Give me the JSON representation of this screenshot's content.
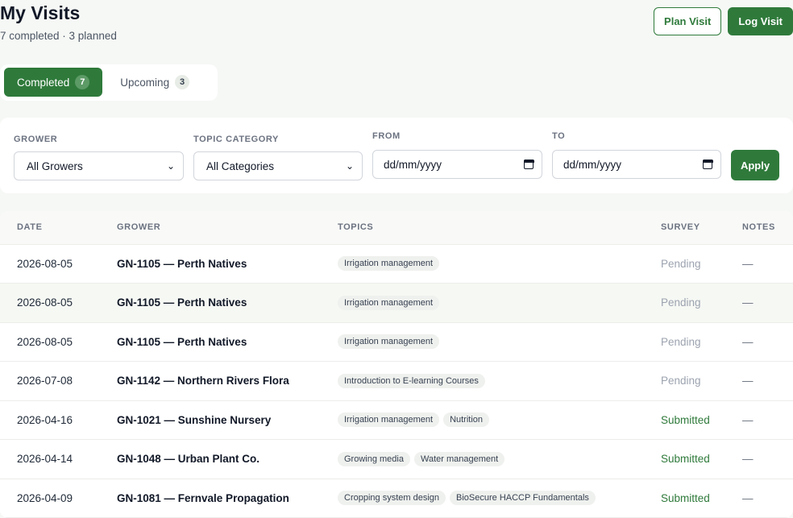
{
  "header": {
    "title": "My Visits",
    "subtitle": "7 completed · 3 planned",
    "plan_visit_label": "Plan Visit",
    "log_visit_label": "Log Visit"
  },
  "tabs": [
    {
      "label": "Completed",
      "count": "7",
      "active": true
    },
    {
      "label": "Upcoming",
      "count": "3",
      "active": false
    }
  ],
  "filters": {
    "grower_label": "GROWER",
    "grower_value": "All Growers",
    "topic_label": "TOPIC CATEGORY",
    "topic_value": "All Categories",
    "from_label": "FROM",
    "from_value": "dd/mm/yyyy",
    "to_label": "TO",
    "to_value": "dd/mm/yyyy",
    "apply_label": "Apply"
  },
  "table": {
    "columns": [
      "DATE",
      "GROWER",
      "TOPICS",
      "SURVEY",
      "NOTES"
    ],
    "rows": [
      {
        "date": "2026-08-05",
        "grower": "GN-1105 — Perth Natives",
        "topics": [
          "Irrigation management"
        ],
        "survey": "Pending",
        "notes": "—"
      },
      {
        "date": "2026-08-05",
        "grower": "GN-1105 — Perth Natives",
        "topics": [
          "Irrigation management"
        ],
        "survey": "Pending",
        "notes": "—"
      },
      {
        "date": "2026-08-05",
        "grower": "GN-1105 — Perth Natives",
        "topics": [
          "Irrigation management"
        ],
        "survey": "Pending",
        "notes": "—"
      },
      {
        "date": "2026-07-08",
        "grower": "GN-1142 — Northern Rivers Flora",
        "topics": [
          "Introduction to E-learning Courses"
        ],
        "survey": "Pending",
        "notes": "—"
      },
      {
        "date": "2026-04-16",
        "grower": "GN-1021 — Sunshine Nursery",
        "topics": [
          "Irrigation management",
          "Nutrition"
        ],
        "survey": "Submitted",
        "notes": "—"
      },
      {
        "date": "2026-04-14",
        "grower": "GN-1048 — Urban Plant Co.",
        "topics": [
          "Growing media",
          "Water management"
        ],
        "survey": "Submitted",
        "notes": "—"
      },
      {
        "date": "2026-04-09",
        "grower": "GN-1081 — Fernvale Propagation",
        "topics": [
          "Cropping system design",
          "BioSecure HACCP Fundamentals"
        ],
        "survey": "Submitted",
        "notes": "—"
      }
    ]
  }
}
